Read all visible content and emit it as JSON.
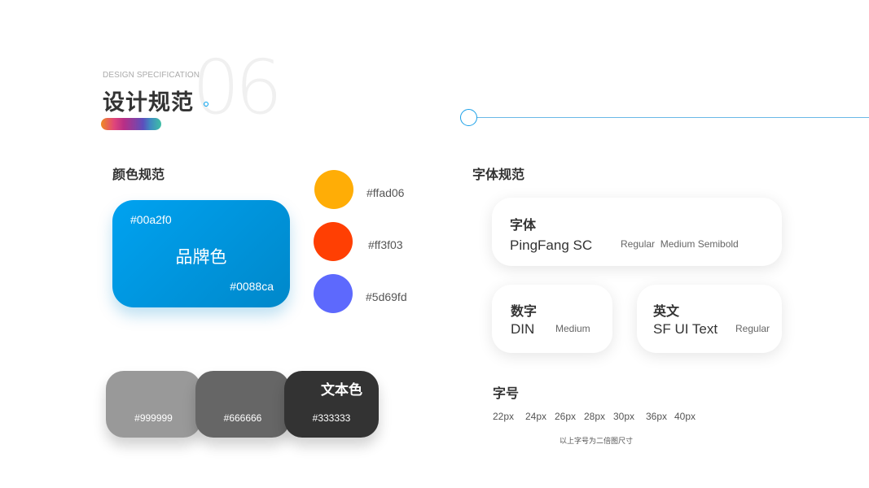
{
  "header": {
    "eyebrow": "DESIGN SPECIFICATION",
    "title": "设计规范",
    "number": "06"
  },
  "colors": {
    "heading": "颜色规范",
    "brand": {
      "label": "品牌色",
      "gradient_start": "#00a2f0",
      "gradient_end": "#0088ca"
    },
    "swatches": [
      {
        "hex": "#ffad06",
        "color": "#ffad06"
      },
      {
        "hex": "#ff3f03",
        "color": "#ff3f03"
      },
      {
        "hex": "#5d69fd",
        "color": "#5d69fd"
      }
    ],
    "grays": [
      {
        "hex": "#999999",
        "color": "#999999"
      },
      {
        "hex": "#666666",
        "color": "#666666"
      },
      {
        "hex": "#333333",
        "color": "#333333"
      }
    ],
    "text_color_label": "文本色"
  },
  "fonts": {
    "heading": "字体规范",
    "main": {
      "caption": "字体",
      "family": "PingFang SC",
      "weights": "Regular  Medium Semibold"
    },
    "number": {
      "caption": "数字",
      "family": "DIN",
      "weight": "Medium"
    },
    "english": {
      "caption": "英文",
      "family": "SF UI Text",
      "weight": "Regular"
    },
    "sizes": {
      "caption": "字号",
      "values": [
        "22px",
        "24px",
        "26px",
        "28px",
        "30px",
        "36px",
        "40px"
      ],
      "note": "以上字号为二倍图尺寸"
    }
  }
}
